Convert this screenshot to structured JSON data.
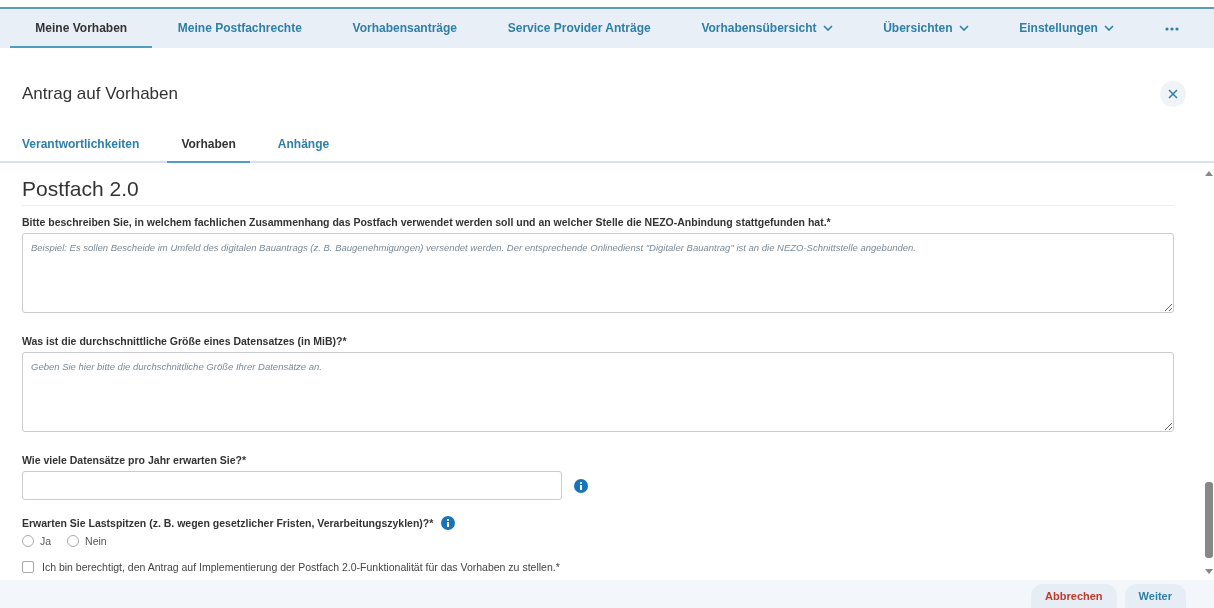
{
  "nav": [
    {
      "label": "Meine Vorhaben",
      "selected": true,
      "dropdown": false
    },
    {
      "label": "Meine Postfachrechte",
      "selected": false,
      "dropdown": false
    },
    {
      "label": "Vorhabensanträge",
      "selected": false,
      "dropdown": false
    },
    {
      "label": "Service Provider Anträge",
      "selected": false,
      "dropdown": false
    },
    {
      "label": "Vorhabensübersicht",
      "selected": false,
      "dropdown": true
    },
    {
      "label": "Übersichten",
      "selected": false,
      "dropdown": true
    },
    {
      "label": "Einstellungen",
      "selected": false,
      "dropdown": true
    }
  ],
  "dialog": {
    "title": "Antrag auf Vorhaben"
  },
  "tabs": [
    {
      "label": "Verantwortlichkeiten",
      "selected": false
    },
    {
      "label": "Vorhaben",
      "selected": true
    },
    {
      "label": "Anhänge",
      "selected": false
    }
  ],
  "section": {
    "title": "Postfach 2.0"
  },
  "fields": [
    {
      "kind": "textarea",
      "label": "Bitte beschreiben Sie, in welchem fachlichen Zusammenhang das Postfach verwendet werden soll und an welcher Stelle die NEZO-Anbindung stattgefunden hat.*",
      "placeholder": "Beispiel: Es sollen Bescheide im Umfeld des digitalen Bauantrags (z. B. Baugenehmigungen) versendet werden. Der entsprechende Onlinedienst \"Digitaler Bauantrag\" ist an die NEZO-Schnittstelle angebunden."
    },
    {
      "kind": "textarea",
      "label": "Was ist die durchschnittliche Größe eines Datensatzes (in MiB)?*",
      "placeholder": "Geben Sie hier bitte die durchschnittliche Größe Ihrer Datensätze an."
    },
    {
      "kind": "input",
      "label": "Wie viele Datensätze pro Jahr erwarten Sie?*"
    },
    {
      "kind": "radio",
      "label": "Erwarten Sie Lastspitzen (z. B. wegen gesetzlicher Fristen, Verarbeitungszyklen)?*",
      "options": [
        {
          "label": "Ja",
          "selected": false
        },
        {
          "label": "Nein",
          "selected": false
        }
      ]
    },
    {
      "kind": "checkbox",
      "label": "Ich bin berechtigt, den Antrag auf Implementierung der Postfach 2.0-Funktionalität für das Vorhaben zu stellen.*",
      "checked": false
    }
  ],
  "footer": {
    "buttons": [
      {
        "label": "Abbrechen",
        "kind": "cancel"
      },
      {
        "label": "Weiter",
        "kind": "primary"
      }
    ]
  }
}
